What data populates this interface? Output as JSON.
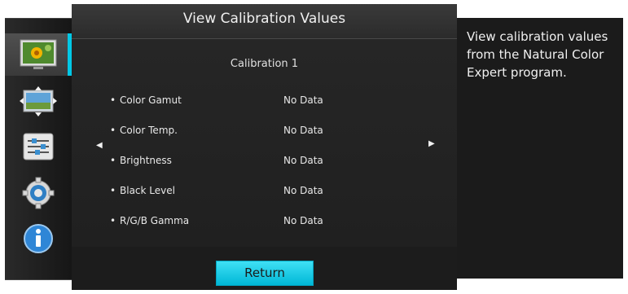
{
  "dialog": {
    "title": "View Calibration Values",
    "calibration_title": "Calibration 1",
    "rows": [
      {
        "label": "Color Gamut",
        "value": "No Data"
      },
      {
        "label": "Color Temp.",
        "value": "No Data"
      },
      {
        "label": "Brightness",
        "value": "No Data"
      },
      {
        "label": "Black Level",
        "value": "No Data"
      },
      {
        "label": "R/G/B Gamma",
        "value": "No Data"
      }
    ],
    "prev_arrow": "◀",
    "next_arrow": "▶",
    "bullet": "•",
    "return_label": "Return"
  },
  "help": {
    "text": "View calibration values from the Natural Color Expert program."
  },
  "menu": {
    "items": [
      {
        "icon": "picture-icon"
      },
      {
        "icon": "onscreen-display-icon"
      },
      {
        "icon": "system-sliders-icon"
      },
      {
        "icon": "settings-gear-icon"
      },
      {
        "icon": "information-icon"
      }
    ],
    "selected_index": 0
  },
  "colors": {
    "accent": "#00c8e6",
    "panel": "#1c1c1c"
  }
}
